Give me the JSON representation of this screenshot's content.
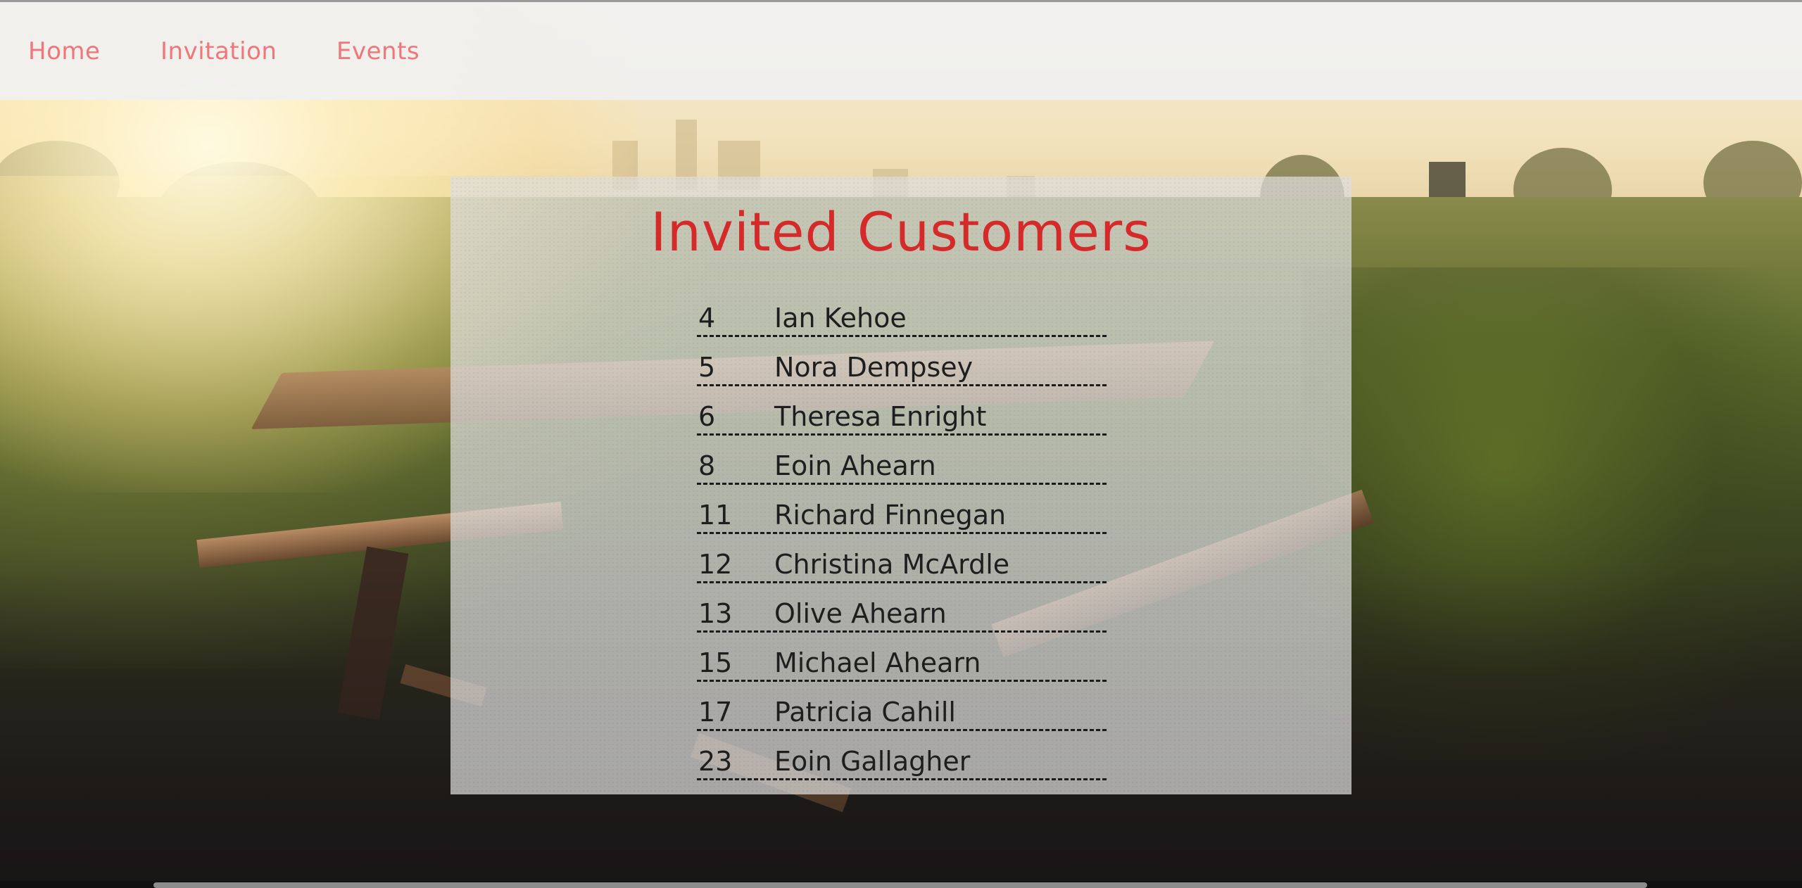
{
  "nav": {
    "items": [
      {
        "label": "Home"
      },
      {
        "label": "Invitation"
      },
      {
        "label": "Events"
      }
    ],
    "link_color": "#f0767a"
  },
  "panel": {
    "title": "Invited Customers",
    "title_color": "#d42a2a"
  },
  "customers": [
    {
      "id": "4",
      "name": "Ian Kehoe"
    },
    {
      "id": "5",
      "name": "Nora Dempsey"
    },
    {
      "id": "6",
      "name": "Theresa Enright"
    },
    {
      "id": "8",
      "name": "Eoin Ahearn"
    },
    {
      "id": "11",
      "name": "Richard Finnegan"
    },
    {
      "id": "12",
      "name": "Christina McArdle"
    },
    {
      "id": "13",
      "name": "Olive Ahearn"
    },
    {
      "id": "15",
      "name": "Michael Ahearn"
    },
    {
      "id": "17",
      "name": "Patricia Cahill"
    },
    {
      "id": "23",
      "name": "Eoin Gallagher"
    }
  ],
  "background": {
    "description_icon": "park-picnic-table-photo"
  }
}
